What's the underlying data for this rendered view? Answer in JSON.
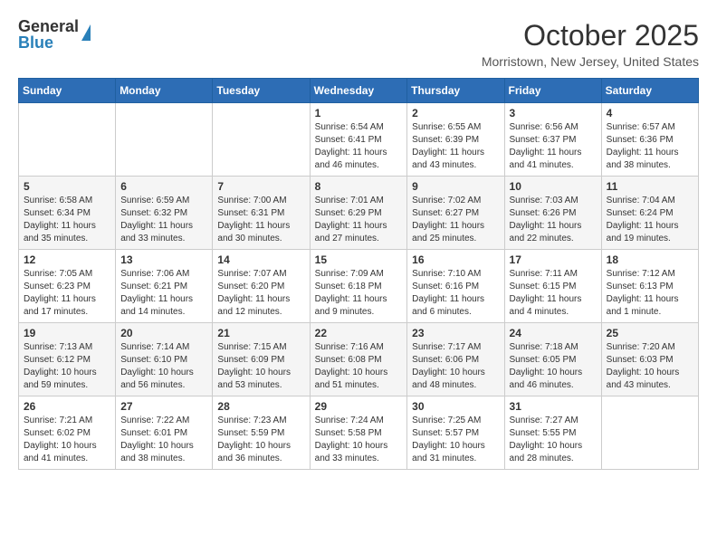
{
  "header": {
    "logo_general": "General",
    "logo_blue": "Blue",
    "month": "October 2025",
    "location": "Morristown, New Jersey, United States"
  },
  "days_of_week": [
    "Sunday",
    "Monday",
    "Tuesday",
    "Wednesday",
    "Thursday",
    "Friday",
    "Saturday"
  ],
  "weeks": [
    [
      {
        "day": "",
        "info": ""
      },
      {
        "day": "",
        "info": ""
      },
      {
        "day": "",
        "info": ""
      },
      {
        "day": "1",
        "info": "Sunrise: 6:54 AM\nSunset: 6:41 PM\nDaylight: 11 hours\nand 46 minutes."
      },
      {
        "day": "2",
        "info": "Sunrise: 6:55 AM\nSunset: 6:39 PM\nDaylight: 11 hours\nand 43 minutes."
      },
      {
        "day": "3",
        "info": "Sunrise: 6:56 AM\nSunset: 6:37 PM\nDaylight: 11 hours\nand 41 minutes."
      },
      {
        "day": "4",
        "info": "Sunrise: 6:57 AM\nSunset: 6:36 PM\nDaylight: 11 hours\nand 38 minutes."
      }
    ],
    [
      {
        "day": "5",
        "info": "Sunrise: 6:58 AM\nSunset: 6:34 PM\nDaylight: 11 hours\nand 35 minutes."
      },
      {
        "day": "6",
        "info": "Sunrise: 6:59 AM\nSunset: 6:32 PM\nDaylight: 11 hours\nand 33 minutes."
      },
      {
        "day": "7",
        "info": "Sunrise: 7:00 AM\nSunset: 6:31 PM\nDaylight: 11 hours\nand 30 minutes."
      },
      {
        "day": "8",
        "info": "Sunrise: 7:01 AM\nSunset: 6:29 PM\nDaylight: 11 hours\nand 27 minutes."
      },
      {
        "day": "9",
        "info": "Sunrise: 7:02 AM\nSunset: 6:27 PM\nDaylight: 11 hours\nand 25 minutes."
      },
      {
        "day": "10",
        "info": "Sunrise: 7:03 AM\nSunset: 6:26 PM\nDaylight: 11 hours\nand 22 minutes."
      },
      {
        "day": "11",
        "info": "Sunrise: 7:04 AM\nSunset: 6:24 PM\nDaylight: 11 hours\nand 19 minutes."
      }
    ],
    [
      {
        "day": "12",
        "info": "Sunrise: 7:05 AM\nSunset: 6:23 PM\nDaylight: 11 hours\nand 17 minutes."
      },
      {
        "day": "13",
        "info": "Sunrise: 7:06 AM\nSunset: 6:21 PM\nDaylight: 11 hours\nand 14 minutes."
      },
      {
        "day": "14",
        "info": "Sunrise: 7:07 AM\nSunset: 6:20 PM\nDaylight: 11 hours\nand 12 minutes."
      },
      {
        "day": "15",
        "info": "Sunrise: 7:09 AM\nSunset: 6:18 PM\nDaylight: 11 hours\nand 9 minutes."
      },
      {
        "day": "16",
        "info": "Sunrise: 7:10 AM\nSunset: 6:16 PM\nDaylight: 11 hours\nand 6 minutes."
      },
      {
        "day": "17",
        "info": "Sunrise: 7:11 AM\nSunset: 6:15 PM\nDaylight: 11 hours\nand 4 minutes."
      },
      {
        "day": "18",
        "info": "Sunrise: 7:12 AM\nSunset: 6:13 PM\nDaylight: 11 hours\nand 1 minute."
      }
    ],
    [
      {
        "day": "19",
        "info": "Sunrise: 7:13 AM\nSunset: 6:12 PM\nDaylight: 10 hours\nand 59 minutes."
      },
      {
        "day": "20",
        "info": "Sunrise: 7:14 AM\nSunset: 6:10 PM\nDaylight: 10 hours\nand 56 minutes."
      },
      {
        "day": "21",
        "info": "Sunrise: 7:15 AM\nSunset: 6:09 PM\nDaylight: 10 hours\nand 53 minutes."
      },
      {
        "day": "22",
        "info": "Sunrise: 7:16 AM\nSunset: 6:08 PM\nDaylight: 10 hours\nand 51 minutes."
      },
      {
        "day": "23",
        "info": "Sunrise: 7:17 AM\nSunset: 6:06 PM\nDaylight: 10 hours\nand 48 minutes."
      },
      {
        "day": "24",
        "info": "Sunrise: 7:18 AM\nSunset: 6:05 PM\nDaylight: 10 hours\nand 46 minutes."
      },
      {
        "day": "25",
        "info": "Sunrise: 7:20 AM\nSunset: 6:03 PM\nDaylight: 10 hours\nand 43 minutes."
      }
    ],
    [
      {
        "day": "26",
        "info": "Sunrise: 7:21 AM\nSunset: 6:02 PM\nDaylight: 10 hours\nand 41 minutes."
      },
      {
        "day": "27",
        "info": "Sunrise: 7:22 AM\nSunset: 6:01 PM\nDaylight: 10 hours\nand 38 minutes."
      },
      {
        "day": "28",
        "info": "Sunrise: 7:23 AM\nSunset: 5:59 PM\nDaylight: 10 hours\nand 36 minutes."
      },
      {
        "day": "29",
        "info": "Sunrise: 7:24 AM\nSunset: 5:58 PM\nDaylight: 10 hours\nand 33 minutes."
      },
      {
        "day": "30",
        "info": "Sunrise: 7:25 AM\nSunset: 5:57 PM\nDaylight: 10 hours\nand 31 minutes."
      },
      {
        "day": "31",
        "info": "Sunrise: 7:27 AM\nSunset: 5:55 PM\nDaylight: 10 hours\nand 28 minutes."
      },
      {
        "day": "",
        "info": ""
      }
    ]
  ]
}
